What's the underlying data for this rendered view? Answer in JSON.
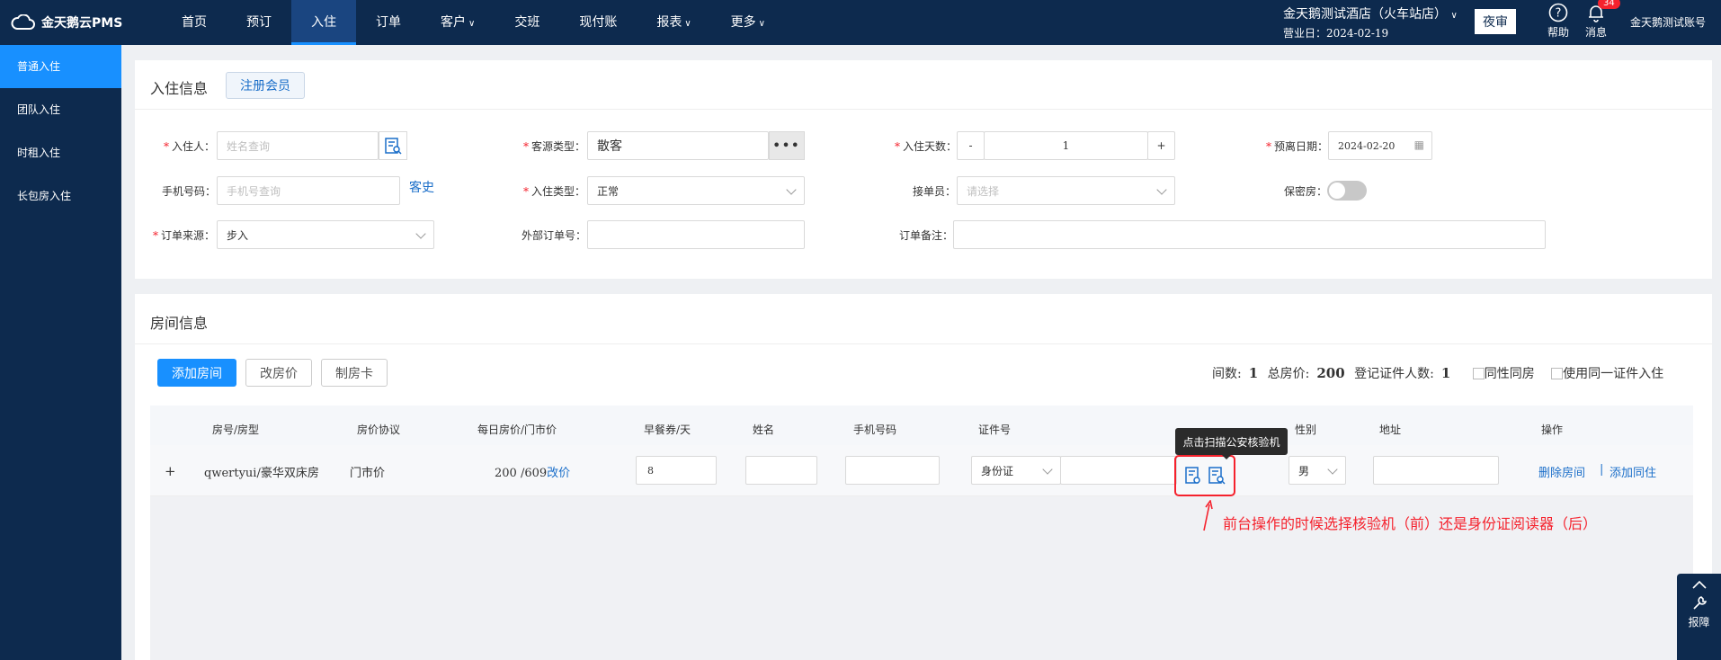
{
  "topbar": {
    "logo": "金天鹅云PMS",
    "nav": [
      {
        "label": "首页",
        "dropdown": false
      },
      {
        "label": "预订",
        "dropdown": false
      },
      {
        "label": "入住",
        "dropdown": false,
        "active": true
      },
      {
        "label": "订单",
        "dropdown": false
      },
      {
        "label": "客户",
        "dropdown": true
      },
      {
        "label": "交班",
        "dropdown": false
      },
      {
        "label": "现付账",
        "dropdown": false
      },
      {
        "label": "报表",
        "dropdown": true
      },
      {
        "label": "更多",
        "dropdown": true
      }
    ],
    "hotel_name": "金天鹅测试酒店（火车站店）",
    "business_date": "营业日：2024-02-19",
    "night_audit": "夜审",
    "help": "帮助",
    "messages": "消息",
    "message_count": "34",
    "account": "金天鹅测试账号"
  },
  "sidebar": {
    "items": [
      "普通入住",
      "团队入住",
      "时租入住",
      "长包房入住"
    ]
  },
  "checkin": {
    "title": "入住信息",
    "register_member": "注册会员",
    "guest_label": "入住人：",
    "guest_placeholder": "姓名查询",
    "source_type_label": "客源类型：",
    "source_type_value": "散客",
    "days_label": "入住天数：",
    "days_minus": "-",
    "days_value": "1",
    "days_plus": "+",
    "departure_label": "预离日期：",
    "departure_value": "2024-02-20",
    "phone_label": "手机号码：",
    "phone_placeholder": "手机号查询",
    "guest_history": "客史",
    "checkin_type_label": "入住类型：",
    "checkin_type_value": "正常",
    "receptionist_label": "接单员：",
    "receptionist_placeholder": "请选择",
    "private_label": "保密房：",
    "order_source_label": "订单来源：",
    "order_source_value": "步入",
    "external_order_label": "外部订单号：",
    "order_remark_label": "订单备注："
  },
  "room": {
    "title": "房间信息",
    "add_room": "添加房间",
    "change_price": "改房价",
    "make_card": "制房卡",
    "stats": {
      "rooms_label": "间数:",
      "rooms_value": "1",
      "total_label": "总房价:",
      "total_value": "200",
      "id_count_label": "登记证件人数:",
      "id_count_value": "1",
      "same_sex": "同性同房",
      "same_id": "使用同一证件入住"
    },
    "columns": [
      "房号/房型",
      "房价协议",
      "每日房价/门市价",
      "早餐券/天",
      "姓名",
      "手机号码",
      "证件号",
      "性别",
      "地址",
      "操作"
    ],
    "row": {
      "expand": "+",
      "room": "qwertyui/豪华双床房",
      "agreement": "门市价",
      "price": "200 /609",
      "change_price_link": "改价",
      "breakfast": "8",
      "id_type": "身份证",
      "gender": "男",
      "delete_room": "删除房间",
      "divider": "|",
      "add_cohabitant": "添加同住"
    },
    "tooltip": "点击扫描公安核验机",
    "annotation": "前台操作的时候选择核验机（前）还是身份证阅读器（后）"
  },
  "float_tool": {
    "report": "报障"
  },
  "colors": {
    "nav_bg": "#0d2a4e",
    "accent": "#1890ff",
    "highlight": "#f5222d"
  }
}
